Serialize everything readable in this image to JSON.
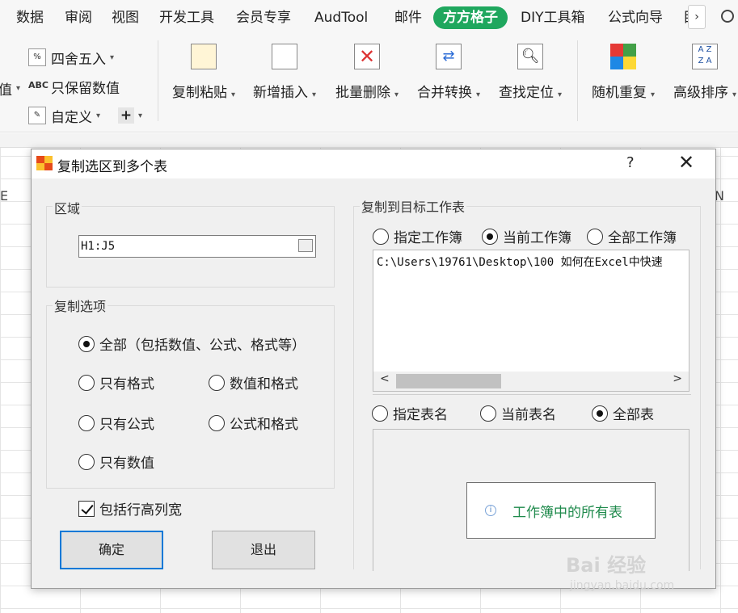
{
  "ribbon_tabs": [
    "数据",
    "审阅",
    "视图",
    "开发工具",
    "会员专享",
    "AudTool",
    "邮件",
    "方方格子",
    "DIY工具箱",
    "公式向导",
    "目"
  ],
  "ribbon_tabs_more": "›",
  "left_partial": {
    "edge_label": "值"
  },
  "small_items": {
    "round": "四舍五入",
    "keep_value": "只保留数值",
    "custom": "自定义",
    "plus": "+"
  },
  "big_buttons": [
    "复制粘贴",
    "新增插入",
    "批量删除",
    "合并转换",
    "查找定位",
    "随机重复",
    "高级排序"
  ],
  "grid": {
    "col_left": "E",
    "col_right": "N"
  },
  "dialog": {
    "title": "复制选区到多个表",
    "help": "?",
    "close": "✕",
    "region_group": "区域",
    "region_value": "H1:J5",
    "copy_options_group": "复制选项",
    "options": {
      "all": "全部（包括数值、公式、格式等）",
      "format_only": "只有格式",
      "value_format": "数值和格式",
      "formula_only": "只有公式",
      "formula_format": "公式和格式",
      "value_only": "只有数值"
    },
    "include_row_col": "包括行高列宽",
    "ok": "确定",
    "exit": "退出",
    "target_group": "复制到目标工作表",
    "workbook_choices": {
      "specified": "指定工作簿",
      "current": "当前工作簿",
      "all": "全部工作簿"
    },
    "workbook_path": "C:\\Users\\19761\\Desktop\\100 如何在Excel中快速",
    "sheet_choices": {
      "specified": "指定表名",
      "current": "当前表名",
      "all": "全部表"
    },
    "sheet_notice": "工作簿中的所有表"
  },
  "watermark": {
    "main": "Bai 经验",
    "sub": "jingyan.baidu.com"
  },
  "colors": {
    "accent_tab": "#1fa75e",
    "primary_border": "#0078d7",
    "notice_text": "#1f8a4c"
  }
}
